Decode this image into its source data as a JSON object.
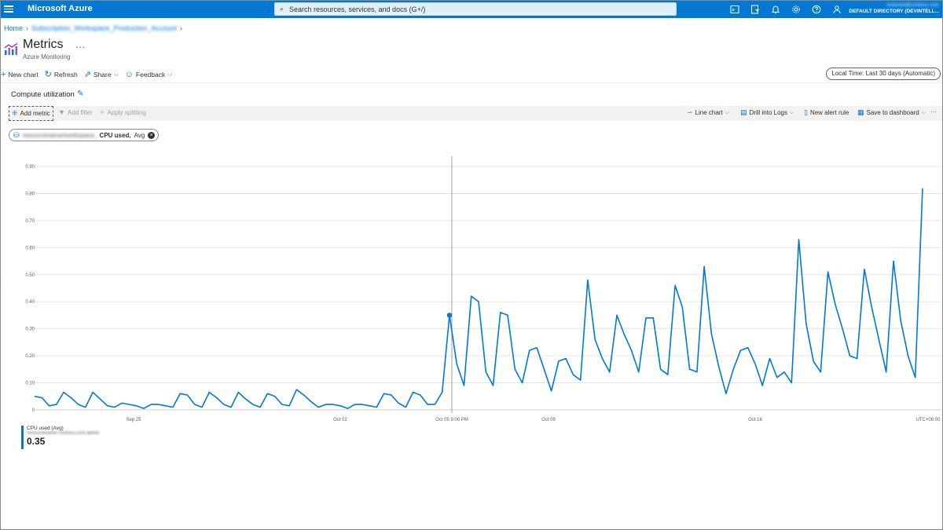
{
  "topbar": {
    "brand": "Microsoft Azure",
    "search_placeholder": "Search resources, services, and docs (G+/)",
    "icons": [
      "cloud-shell-icon",
      "directory-filter-icon",
      "notifications-icon",
      "settings-icon",
      "help-icon",
      "feedback-icon"
    ],
    "account_user": "testuser@contoso.com",
    "account_directory": "DEFAULT DIRECTORY (DEVINTELL..."
  },
  "breadcrumb": {
    "home": "Home",
    "resource": "Subscription_Workspace_Production_Account"
  },
  "header": {
    "title": "Metrics",
    "more": "...",
    "subtitle": "Azure Monitoring"
  },
  "commands": {
    "new_chart": "New chart",
    "refresh": "Refresh",
    "share": "Share",
    "feedback": "Feedback",
    "time_range": "Local Time: Last 30 days (Automatic)"
  },
  "chart_panel": {
    "title": "Compute utilization",
    "toolbar": {
      "add_metric": "Add metric",
      "add_filter": "Add filter",
      "apply_splitting": "Apply splitting",
      "line_chart": "Line chart",
      "drill_logs": "Drill into Logs",
      "new_alert": "New alert rule",
      "save_dashboard": "Save to dashboard",
      "more": "···"
    },
    "metric_pill": {
      "resource": "resourcename/workspace_ws...",
      "metric": "CPU used,",
      "aggregation": "Avg"
    },
    "legend": {
      "name": "CPU used (Avg)",
      "resource": "resourcename-contoso.com.admin",
      "value": "0.35"
    }
  },
  "colors": {
    "accent": "#0078d4",
    "series": "#0078d4",
    "grid": "#e1dfdd"
  },
  "chart_data": {
    "type": "line",
    "ylim": [
      0,
      0.9
    ],
    "yticks": [
      "0",
      "0.10",
      "0.20",
      "0.30",
      "0.40",
      "0.50",
      "0.60",
      "0.70",
      "0.80",
      "0.90"
    ],
    "xtick_labels": [
      "Sep 25",
      "Oct 02",
      "Oct 05 9:00 PM",
      "Oct 09",
      "Oct 16",
      "UTC+06:00"
    ],
    "cursor_label": "Oct 05 9:00 PM",
    "cursor_value": 0.35,
    "series": [
      {
        "name": "CPU used (Avg)",
        "values": [
          0.05,
          0.045,
          0.015,
          0.02,
          0.065,
          0.045,
          0.02,
          0.01,
          0.065,
          0.04,
          0.015,
          0.01,
          0.025,
          0.02,
          0.015,
          0.005,
          0.02,
          0.02,
          0.015,
          0.01,
          0.06,
          0.055,
          0.02,
          0.01,
          0.065,
          0.045,
          0.02,
          0.01,
          0.065,
          0.04,
          0.02,
          0.01,
          0.06,
          0.05,
          0.02,
          0.015,
          0.075,
          0.055,
          0.03,
          0.01,
          0.02,
          0.02,
          0.015,
          0.005,
          0.02,
          0.02,
          0.015,
          0.01,
          0.06,
          0.055,
          0.025,
          0.01,
          0.065,
          0.055,
          0.02,
          0.02,
          0.065,
          0.35,
          0.17,
          0.09,
          0.42,
          0.4,
          0.14,
          0.09,
          0.36,
          0.35,
          0.15,
          0.1,
          0.22,
          0.23,
          0.15,
          0.07,
          0.18,
          0.19,
          0.13,
          0.11,
          0.48,
          0.26,
          0.19,
          0.14,
          0.35,
          0.28,
          0.22,
          0.14,
          0.34,
          0.34,
          0.15,
          0.13,
          0.46,
          0.38,
          0.15,
          0.14,
          0.53,
          0.28,
          0.16,
          0.06,
          0.15,
          0.22,
          0.23,
          0.17,
          0.09,
          0.19,
          0.12,
          0.14,
          0.1,
          0.63,
          0.32,
          0.18,
          0.14,
          0.51,
          0.39,
          0.3,
          0.2,
          0.19,
          0.52,
          0.38,
          0.26,
          0.14,
          0.55,
          0.33,
          0.2,
          0.12,
          0.82
        ]
      }
    ]
  }
}
